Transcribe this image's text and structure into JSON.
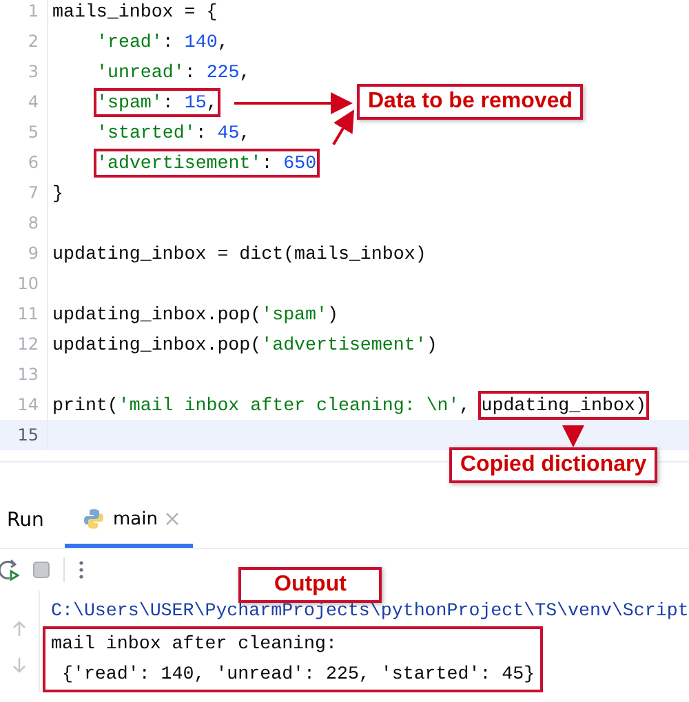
{
  "editor": {
    "lines": [
      {
        "number": "1",
        "current": false,
        "indented": false,
        "segments": [
          {
            "boxed": false,
            "tokens": [
              {
                "text": "mails_inbox = {",
                "kind": "plain"
              }
            ]
          }
        ]
      },
      {
        "number": "2",
        "current": false,
        "indented": true,
        "segments": [
          {
            "boxed": false,
            "tokens": [
              {
                "text": "'read'",
                "kind": "string"
              },
              {
                "text": ": ",
                "kind": "plain"
              },
              {
                "text": "140",
                "kind": "number"
              },
              {
                "text": ",",
                "kind": "plain"
              }
            ]
          }
        ]
      },
      {
        "number": "3",
        "current": false,
        "indented": true,
        "segments": [
          {
            "boxed": false,
            "tokens": [
              {
                "text": "'unread'",
                "kind": "string"
              },
              {
                "text": ": ",
                "kind": "plain"
              },
              {
                "text": "225",
                "kind": "number"
              },
              {
                "text": ",",
                "kind": "plain"
              }
            ]
          }
        ]
      },
      {
        "number": "4",
        "current": false,
        "indented": true,
        "segments": [
          {
            "boxed": true,
            "tokens": [
              {
                "text": "'spam'",
                "kind": "string"
              },
              {
                "text": ": ",
                "kind": "plain"
              },
              {
                "text": "15",
                "kind": "number"
              },
              {
                "text": ",",
                "kind": "plain"
              }
            ]
          }
        ]
      },
      {
        "number": "5",
        "current": false,
        "indented": true,
        "segments": [
          {
            "boxed": false,
            "tokens": [
              {
                "text": "'started'",
                "kind": "string"
              },
              {
                "text": ": ",
                "kind": "plain"
              },
              {
                "text": "45",
                "kind": "number"
              },
              {
                "text": ",",
                "kind": "plain"
              }
            ]
          }
        ]
      },
      {
        "number": "6",
        "current": false,
        "indented": true,
        "segments": [
          {
            "boxed": true,
            "tokens": [
              {
                "text": "'advertisement'",
                "kind": "string"
              },
              {
                "text": ": ",
                "kind": "plain"
              },
              {
                "text": "650",
                "kind": "number"
              }
            ]
          }
        ]
      },
      {
        "number": "7",
        "current": false,
        "indented": false,
        "segments": [
          {
            "boxed": false,
            "tokens": [
              {
                "text": "}",
                "kind": "plain"
              }
            ]
          }
        ]
      },
      {
        "number": "8",
        "current": false
      },
      {
        "number": "9",
        "current": false,
        "indented": false,
        "segments": [
          {
            "boxed": false,
            "tokens": [
              {
                "text": "updating_inbox = dict(mails_inbox)",
                "kind": "plain"
              }
            ]
          }
        ]
      },
      {
        "number": "10",
        "current": false
      },
      {
        "number": "11",
        "current": false,
        "indented": false,
        "segments": [
          {
            "boxed": false,
            "tokens": [
              {
                "text": "updating_inbox.pop(",
                "kind": "plain"
              },
              {
                "text": "'spam'",
                "kind": "string"
              },
              {
                "text": ")",
                "kind": "plain"
              }
            ]
          }
        ]
      },
      {
        "number": "12",
        "current": false,
        "indented": false,
        "segments": [
          {
            "boxed": false,
            "tokens": [
              {
                "text": "updating_inbox.pop(",
                "kind": "plain"
              },
              {
                "text": "'advertisement'",
                "kind": "string"
              },
              {
                "text": ")",
                "kind": "plain"
              }
            ]
          }
        ]
      },
      {
        "number": "13",
        "current": false
      },
      {
        "number": "14",
        "current": false,
        "indented": false,
        "segments": [
          {
            "boxed": false,
            "tokens": [
              {
                "text": "print(",
                "kind": "plain"
              },
              {
                "text": "'mail inbox after cleaning: \\n'",
                "kind": "string"
              },
              {
                "text": ", ",
                "kind": "plain"
              }
            ]
          },
          {
            "boxed": true,
            "tokens": [
              {
                "text": "updating_inbox)",
                "kind": "plain"
              }
            ]
          }
        ]
      },
      {
        "number": "15",
        "current": true
      }
    ]
  },
  "annotations": [
    {
      "text": "Data to be removed"
    },
    {
      "text": "Copied dictionary"
    },
    {
      "text": "Output"
    }
  ],
  "run_panel": {
    "title": "Run",
    "tabs": [
      {
        "label": "main",
        "selected": true
      }
    ],
    "console": [
      {
        "text": "C:\\Users\\USER\\PycharmProjects\\pythonProject\\TS\\venv\\Script",
        "boxed": false
      },
      {
        "text": "mail inbox after cleaning:",
        "boxed": true
      },
      {
        "text": " {'read': 140, 'unread': 225, 'started': 45}",
        "boxed": true
      }
    ]
  }
}
